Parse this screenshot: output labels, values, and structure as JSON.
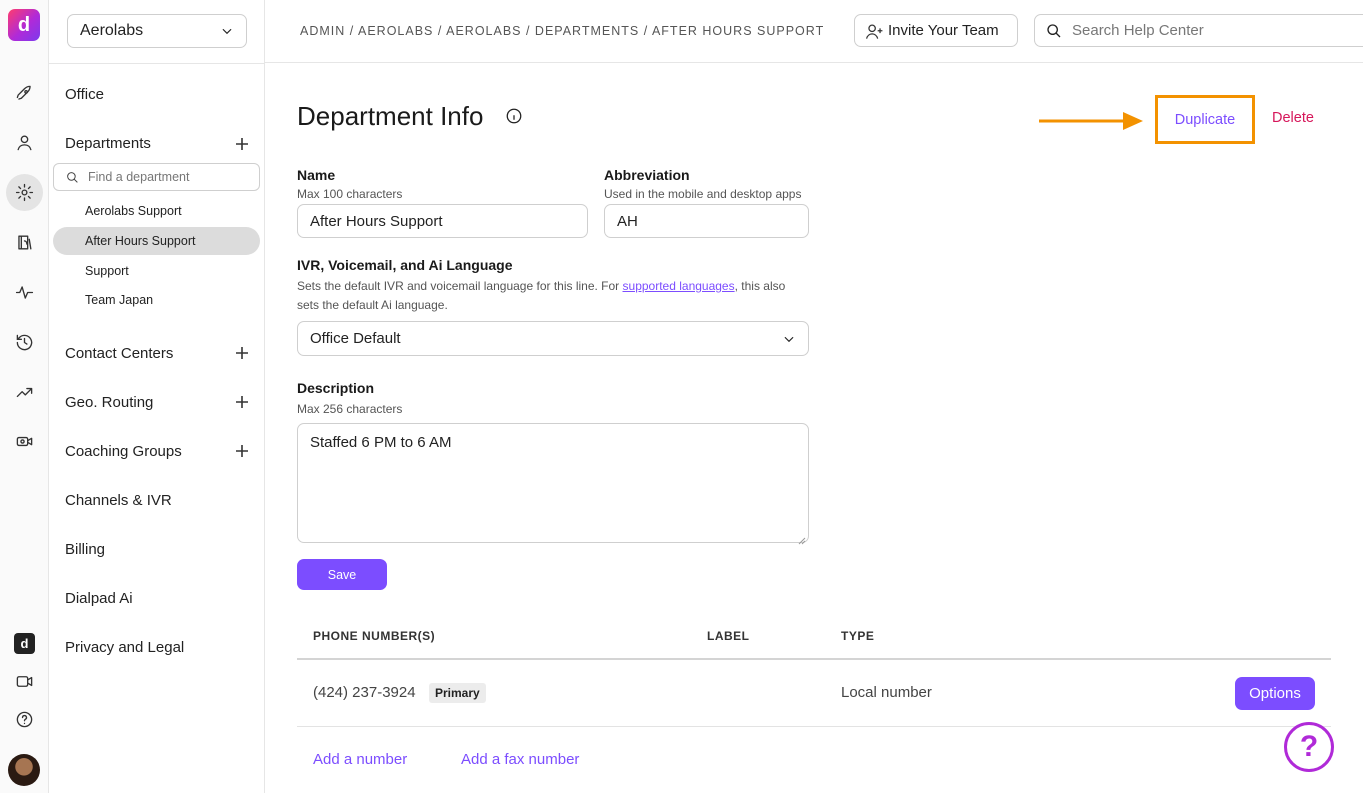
{
  "org_selector": {
    "value": "Aerolabs"
  },
  "sidebar": {
    "office": "Office",
    "departments": "Departments",
    "dept_search_placeholder": "Find a department",
    "dept_items": [
      "Aerolabs Support",
      "After Hours Support",
      "Support",
      "Team Japan"
    ],
    "contact_centers": "Contact Centers",
    "geo_routing": "Geo. Routing",
    "coaching_groups": "Coaching Groups",
    "channels_ivr": "Channels & IVR",
    "billing": "Billing",
    "dialpad_ai": "Dialpad Ai",
    "privacy_legal": "Privacy and Legal"
  },
  "topbar": {
    "breadcrumb": "ADMIN / AEROLABS / AEROLABS / DEPARTMENTS / AFTER HOURS SUPPORT",
    "invite_label": "Invite Your Team",
    "help_search_placeholder": "Search Help Center"
  },
  "page": {
    "title": "Department Info",
    "duplicate_label": "Duplicate",
    "delete_label": "Delete"
  },
  "form": {
    "name_label": "Name",
    "name_hint": "Max 100 characters",
    "name_value": "After Hours Support",
    "abbr_label": "Abbreviation",
    "abbr_hint": "Used in the mobile and desktop apps",
    "abbr_value": "AH",
    "lang_label": "IVR, Voicemail, and Ai Language",
    "lang_hint_1": "Sets the default IVR and voicemail language for this line. For ",
    "lang_hint_link": "supported languages",
    "lang_hint_2": ", this also sets the default Ai language.",
    "lang_value": "Office Default",
    "desc_label": "Description",
    "desc_hint": "Max 256 characters",
    "desc_value": "Staffed 6 PM to 6 AM",
    "save_label": "Save"
  },
  "phone_table": {
    "headers": [
      "PHONE NUMBER(S)",
      "LABEL",
      "TYPE"
    ],
    "rows": [
      {
        "number": "(424) 237-3924",
        "badge": "Primary",
        "label": "",
        "type": "Local number",
        "options": "Options"
      }
    ],
    "add_number": "Add a number",
    "add_fax": "Add a fax number"
  },
  "colors": {
    "accent": "#7c4dff",
    "delete": "#d6165a",
    "highlight": "#f39200"
  },
  "icons": {
    "rail": [
      "rocket-icon",
      "person-icon",
      "gear-icon",
      "contacts-icon",
      "activity-icon",
      "history-icon",
      "trending-icon",
      "meeting-icon",
      "dialpad-logo-icon",
      "video-icon",
      "help-icon"
    ]
  }
}
